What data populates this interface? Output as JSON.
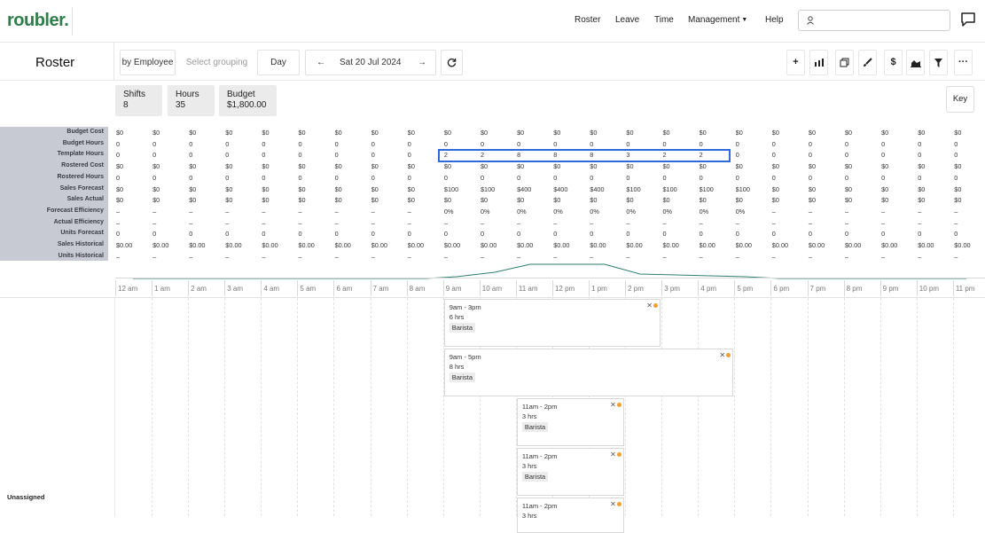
{
  "header": {
    "logo": "roubler.",
    "nav": [
      "Roster",
      "Leave",
      "Time",
      "Management",
      "Help"
    ],
    "search_placeholder": ""
  },
  "toolbar": {
    "title": "Roster",
    "by_employee": "by Employee",
    "select_grouping": "Select grouping",
    "view": "Day",
    "prev": "←",
    "date": "Sat 20 Jul 2024",
    "next": "→",
    "icons": [
      "plus-icon",
      "bar-chart-icon",
      "copy-icon",
      "brush-icon",
      "dollar-icon",
      "area-chart-icon",
      "filter-icon",
      "more-icon"
    ],
    "dollar_label": "$",
    "plus_label": "+",
    "more_label": "···"
  },
  "summary": {
    "shifts_label": "Shifts",
    "shifts_value": "8",
    "hours_label": "Hours",
    "hours_value": "35",
    "budget_label": "Budget",
    "budget_value": "$1,800.00",
    "key_label": "Key"
  },
  "metrics": {
    "labels": [
      "Budget Cost",
      "Budget Hours",
      "Template Hours",
      "Rostered Cost",
      "Rostered Hours",
      "Sales Forecast",
      "Sales Actual",
      "Forecast Efficiency",
      "Actual Efficiency",
      "Units Forecast",
      "Sales Historical",
      "Units Historical"
    ],
    "rows": [
      [
        "$0",
        "$0",
        "$0",
        "$0",
        "$0",
        "$0",
        "$0",
        "$0",
        "$0",
        "$0",
        "$0",
        "$0",
        "$0",
        "$0",
        "$0",
        "$0",
        "$0",
        "$0",
        "$0",
        "$0",
        "$0",
        "$0",
        "$0",
        "$0"
      ],
      [
        "0",
        "0",
        "0",
        "0",
        "0",
        "0",
        "0",
        "0",
        "0",
        "0",
        "0",
        "0",
        "0",
        "0",
        "0",
        "0",
        "0",
        "0",
        "0",
        "0",
        "0",
        "0",
        "0",
        "0"
      ],
      [
        "0",
        "0",
        "0",
        "0",
        "0",
        "0",
        "0",
        "0",
        "0",
        "2",
        "2",
        "8",
        "8",
        "8",
        "3",
        "2",
        "2",
        "0",
        "0",
        "0",
        "0",
        "0",
        "0",
        "0"
      ],
      [
        "$0",
        "$0",
        "$0",
        "$0",
        "$0",
        "$0",
        "$0",
        "$0",
        "$0",
        "$0",
        "$0",
        "$0",
        "$0",
        "$0",
        "$0",
        "$0",
        "$0",
        "$0",
        "$0",
        "$0",
        "$0",
        "$0",
        "$0",
        "$0"
      ],
      [
        "0",
        "0",
        "0",
        "0",
        "0",
        "0",
        "0",
        "0",
        "0",
        "0",
        "0",
        "0",
        "0",
        "0",
        "0",
        "0",
        "0",
        "0",
        "0",
        "0",
        "0",
        "0",
        "0",
        "0"
      ],
      [
        "$0",
        "$0",
        "$0",
        "$0",
        "$0",
        "$0",
        "$0",
        "$0",
        "$0",
        "$100",
        "$100",
        "$400",
        "$400",
        "$400",
        "$100",
        "$100",
        "$100",
        "$100",
        "$0",
        "$0",
        "$0",
        "$0",
        "$0",
        "$0"
      ],
      [
        "$0",
        "$0",
        "$0",
        "$0",
        "$0",
        "$0",
        "$0",
        "$0",
        "$0",
        "$0",
        "$0",
        "$0",
        "$0",
        "$0",
        "$0",
        "$0",
        "$0",
        "$0",
        "$0",
        "$0",
        "$0",
        "$0",
        "$0",
        "$0"
      ],
      [
        "–",
        "–",
        "–",
        "–",
        "–",
        "–",
        "–",
        "–",
        "–",
        "0%",
        "0%",
        "0%",
        "0%",
        "0%",
        "0%",
        "0%",
        "0%",
        "0%",
        "–",
        "–",
        "–",
        "–",
        "–",
        "–"
      ],
      [
        "–",
        "–",
        "–",
        "–",
        "–",
        "–",
        "–",
        "–",
        "–",
        "–",
        "–",
        "–",
        "–",
        "–",
        "–",
        "–",
        "–",
        "–",
        "–",
        "–",
        "–",
        "–",
        "–",
        "–"
      ],
      [
        "0",
        "0",
        "0",
        "0",
        "0",
        "0",
        "0",
        "0",
        "0",
        "0",
        "0",
        "0",
        "0",
        "0",
        "0",
        "0",
        "0",
        "0",
        "0",
        "0",
        "0",
        "0",
        "0",
        "0"
      ],
      [
        "$0.00",
        "$0.00",
        "$0.00",
        "$0.00",
        "$0.00",
        "$0.00",
        "$0.00",
        "$0.00",
        "$0.00",
        "$0.00",
        "$0.00",
        "$0.00",
        "$0.00",
        "$0.00",
        "$0.00",
        "$0.00",
        "$0.00",
        "$0.00",
        "$0.00",
        "$0.00",
        "$0.00",
        "$0.00",
        "$0.00",
        "$0.00"
      ],
      [
        "–",
        "–",
        "–",
        "–",
        "–",
        "–",
        "–",
        "–",
        "–",
        "–",
        "–",
        "–",
        "–",
        "–",
        "–",
        "–",
        "–",
        "–",
        "–",
        "–",
        "–",
        "–",
        "–",
        "–"
      ]
    ]
  },
  "timeline": {
    "hours": [
      "12 am",
      "1 am",
      "2 am",
      "3 am",
      "4 am",
      "5 am",
      "6 am",
      "7 am",
      "8 am",
      "9 am",
      "10 am",
      "11 am",
      "12 pm",
      "1 pm",
      "2 pm",
      "3 pm",
      "4 pm",
      "5 pm",
      "6 pm",
      "7 pm",
      "8 pm",
      "9 pm",
      "10 pm",
      "11 pm"
    ],
    "curve_color": "#2f7d6e"
  },
  "rows": {
    "unassigned_label": "Unassigned"
  },
  "shifts": [
    {
      "time": "9am - 3pm",
      "hours": "6 hrs",
      "role": "Barista",
      "start": 9,
      "end": 15
    },
    {
      "time": "9am - 5pm",
      "hours": "8 hrs",
      "role": "Barista",
      "start": 9,
      "end": 17
    },
    {
      "time": "11am - 2pm",
      "hours": "3 hrs",
      "role": "Barista",
      "start": 11,
      "end": 14
    },
    {
      "time": "11am - 2pm",
      "hours": "3 hrs",
      "role": "Barista",
      "start": 11,
      "end": 14
    },
    {
      "time": "11am - 2pm",
      "hours": "3 hrs",
      "role": "",
      "start": 11,
      "end": 14
    }
  ],
  "shift_partial_text": "3 hrs",
  "shift_icon_glyph": "✕"
}
